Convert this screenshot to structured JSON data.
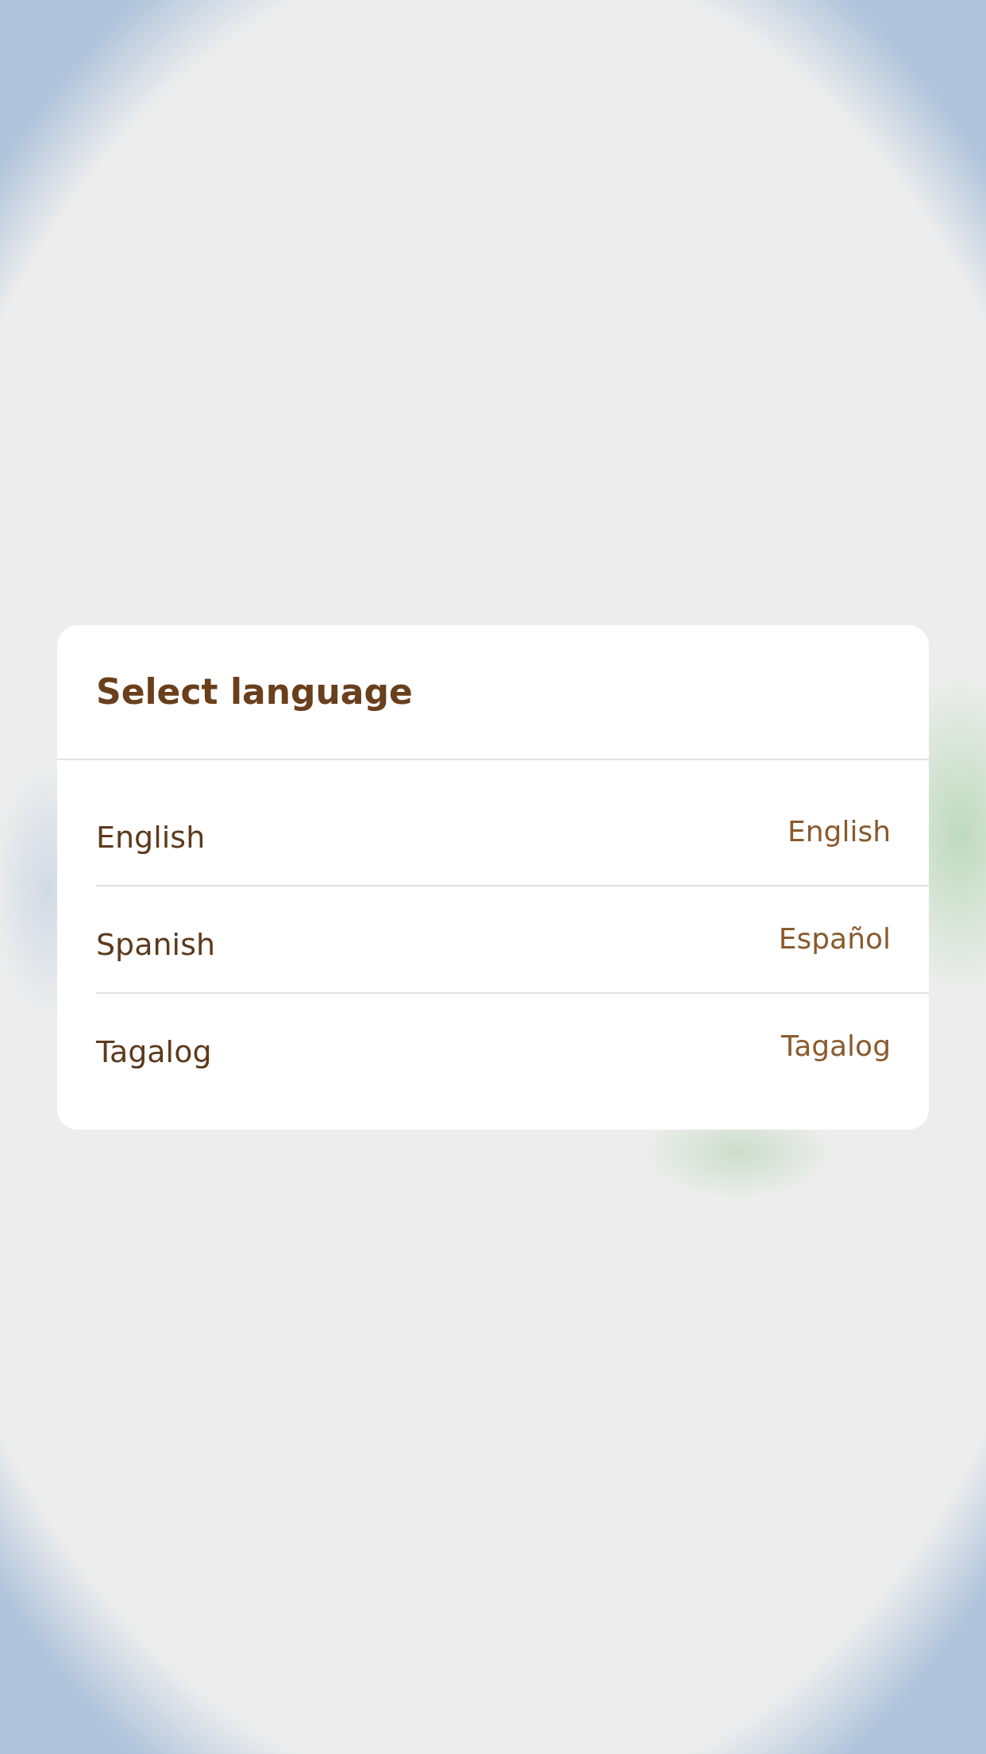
{
  "dialog": {
    "title": "Select language",
    "options": [
      {
        "name": "English",
        "native_name": "English"
      },
      {
        "name": "Spanish",
        "native_name": "Español"
      },
      {
        "name": "Tagalog",
        "native_name": "Tagalog"
      }
    ]
  }
}
